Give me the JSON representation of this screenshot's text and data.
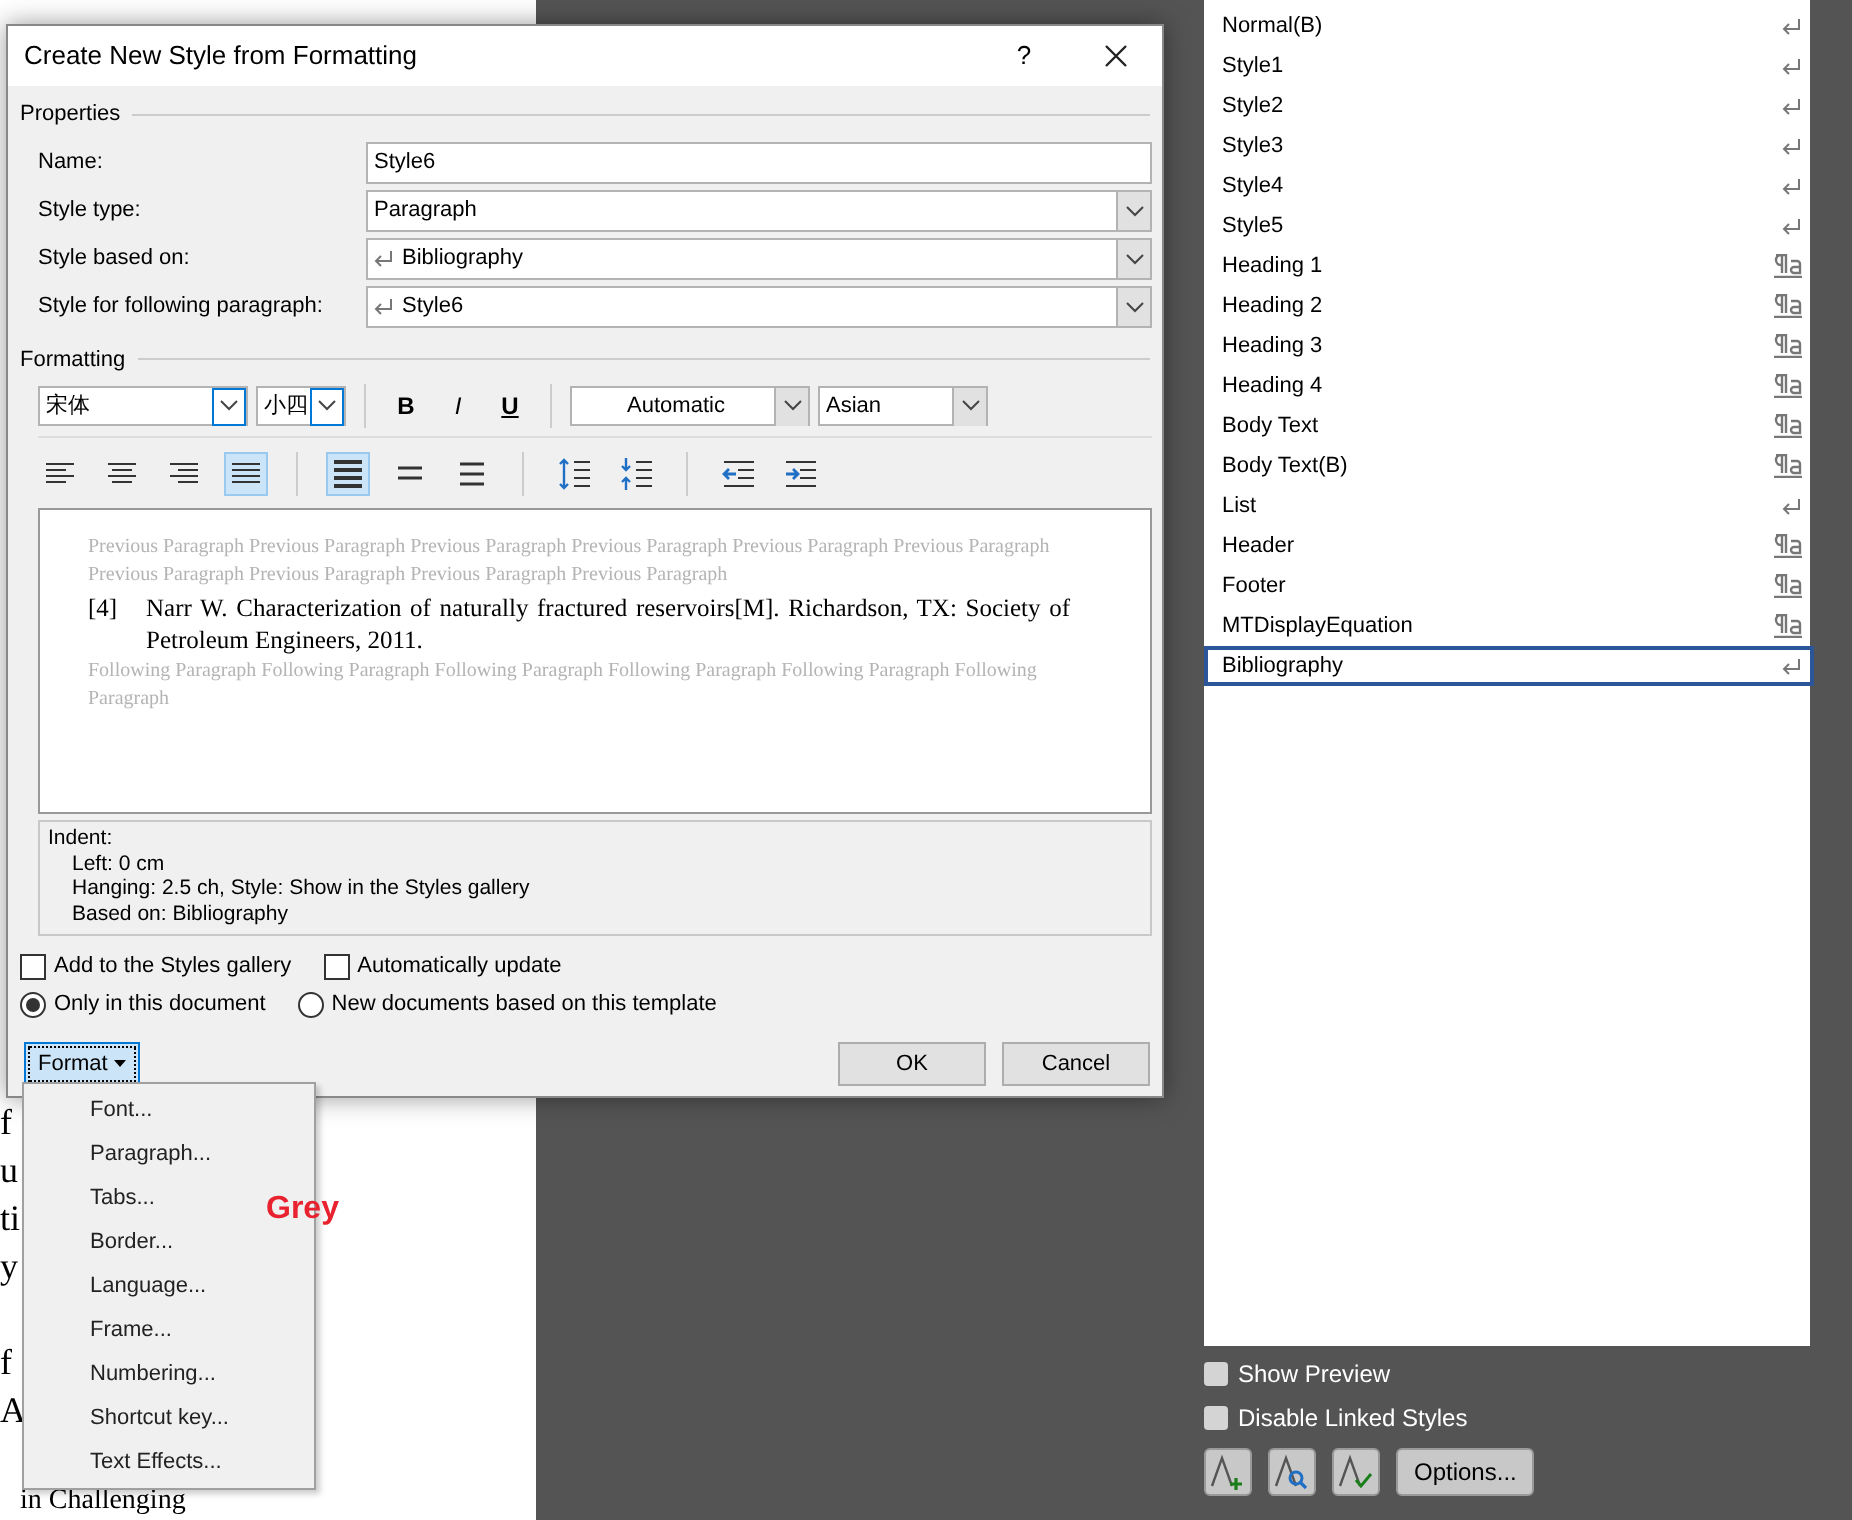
{
  "document": {
    "paragraphs": [
      {
        "lines": [
          "f",
          "u",
          "ti",
          "y"
        ]
      },
      {
        "lines": [
          "f",
          "A"
        ]
      },
      {
        "lines": [
          "in Challenging"
        ]
      }
    ]
  },
  "dialog": {
    "title": "Create New Style from Formatting",
    "help": "?",
    "properties": {
      "heading": "Properties",
      "fields": [
        {
          "label": "Name:",
          "value": "Style6",
          "kind": "text",
          "return_mark": false
        },
        {
          "label": "Style type:",
          "value": "Paragraph",
          "kind": "select",
          "return_mark": false
        },
        {
          "label": "Style based on:",
          "value": "Bibliography",
          "kind": "select",
          "return_mark": true
        },
        {
          "label": "Style for following paragraph:",
          "value": "Style6",
          "kind": "select",
          "return_mark": true
        }
      ]
    },
    "formatting": {
      "heading": "Formatting",
      "font": "宋体",
      "size": "小四",
      "bold": "B",
      "italic": "I",
      "underline": "U",
      "text_shade": "Automatic",
      "script": "Asian",
      "tools": [
        {
          "kind": "align-left",
          "selected": false
        },
        {
          "kind": "align-center",
          "selected": false
        },
        {
          "kind": "align-right",
          "selected": false
        },
        {
          "kind": "justify",
          "selected": true
        },
        {
          "kind": "sep"
        },
        {
          "kind": "spacing-single",
          "selected": true
        },
        {
          "kind": "spacing-one-half",
          "selected": false
        },
        {
          "kind": "spacing-double",
          "selected": false
        },
        {
          "kind": "sep"
        },
        {
          "kind": "space-increase",
          "selected": false
        },
        {
          "kind": "space-decrease",
          "selected": false
        },
        {
          "kind": "sep"
        },
        {
          "kind": "indent-decrease",
          "selected": false
        },
        {
          "kind": "indent-increase",
          "selected": false
        }
      ]
    },
    "preview": {
      "previous": "Previous Paragraph Previous Paragraph Previous Paragraph Previous Paragraph Previous Paragraph Previous Paragraph Previous Paragraph Previous Paragraph Previous Paragraph Previous Paragraph",
      "number": "[4]",
      "sample": "Narr W. Characterization of naturally fractured reservoirs[M]. Richardson, TX: Society of Petroleum Engineers, 2011.",
      "following": "Following Paragraph Following Paragraph Following Paragraph Following Paragraph Following Paragraph Following Paragraph"
    },
    "description": [
      {
        "text": "Indent:",
        "indented": false
      },
      {
        "text": "Left:  0 cm",
        "indented": true
      },
      {
        "text": "Hanging:  2.5 ch, Style: Show in the Styles gallery",
        "indented": true
      },
      {
        "text": "Based on: Bibliography",
        "indented": true
      }
    ],
    "checkboxes": [
      {
        "label": "Add to the Styles gallery",
        "checked": false
      },
      {
        "label": "Automatically update",
        "checked": false
      }
    ],
    "radios": [
      {
        "label": "Only in this document",
        "selected": true
      },
      {
        "label": "New documents based on this template",
        "selected": false
      }
    ],
    "format_button": "Format",
    "ok": "OK",
    "cancel": "Cancel"
  },
  "format_menu": [
    "Font...",
    "Paragraph...",
    "Tabs...",
    "Border...",
    "Language...",
    "Frame...",
    "Numbering...",
    "Shortcut key...",
    "Text Effects..."
  ],
  "annotation": "Grey",
  "styles_pane": {
    "items": [
      {
        "name": "Normal(B)",
        "kind": "paragraph",
        "selected": false
      },
      {
        "name": "Style1",
        "kind": "paragraph",
        "selected": false
      },
      {
        "name": "Style2",
        "kind": "paragraph",
        "selected": false
      },
      {
        "name": "Style3",
        "kind": "paragraph",
        "selected": false
      },
      {
        "name": "Style4",
        "kind": "paragraph",
        "selected": false
      },
      {
        "name": "Style5",
        "kind": "paragraph",
        "selected": false
      },
      {
        "name": "Heading 1",
        "kind": "linked",
        "selected": false
      },
      {
        "name": "Heading 2",
        "kind": "linked",
        "selected": false
      },
      {
        "name": "Heading 3",
        "kind": "linked",
        "selected": false
      },
      {
        "name": "Heading 4",
        "kind": "linked",
        "selected": false
      },
      {
        "name": "Body Text",
        "kind": "linked",
        "selected": false
      },
      {
        "name": "Body Text(B)",
        "kind": "linked",
        "selected": false
      },
      {
        "name": "List",
        "kind": "paragraph",
        "selected": false
      },
      {
        "name": "Header",
        "kind": "linked",
        "selected": false
      },
      {
        "name": "Footer",
        "kind": "linked",
        "selected": false
      },
      {
        "name": "MTDisplayEquation",
        "kind": "linked",
        "selected": false
      },
      {
        "name": "Bibliography",
        "kind": "paragraph",
        "selected": true
      }
    ],
    "options": [
      {
        "label": "Show Preview",
        "checked": false
      },
      {
        "label": "Disable Linked Styles",
        "checked": false
      }
    ],
    "options_button": "Options..."
  }
}
